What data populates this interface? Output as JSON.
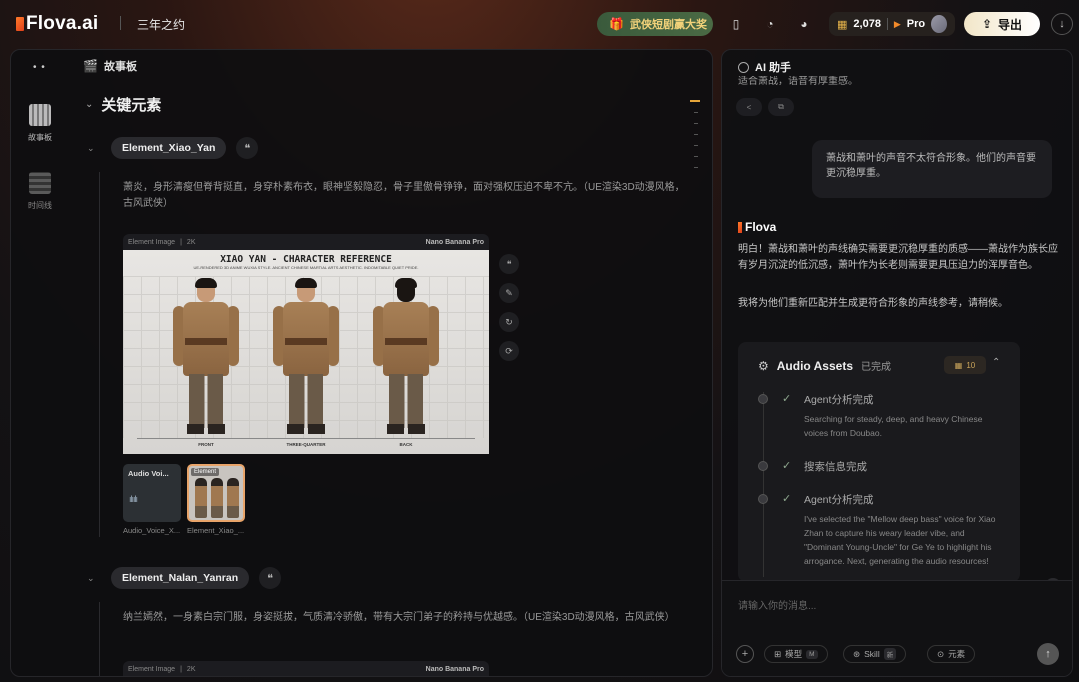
{
  "header": {
    "logo_text": "Flova.ai",
    "project_name": "三年之约",
    "promo_label": "武侠短剧赢大奖",
    "credits": "2,078",
    "plan": "Pro",
    "export_label": "导出"
  },
  "sidebar": {
    "items": [
      {
        "label": "故事板"
      },
      {
        "label": "时间线"
      }
    ]
  },
  "board": {
    "title": "故事板",
    "section_title": "关键元素",
    "elements": [
      {
        "name": "Element_Xiao_Yan",
        "desc": "萧炎，身形清瘦但脊背挺直，身穿朴素布衣，眼神坚毅隐忍，骨子里傲骨铮铮，面对强权压迫不卑不亢。（UE渲染3D动漫风格，古风武侠）",
        "image_meta": {
          "kind": "Element Image",
          "res": "2K",
          "model": "Nano Banana Pro"
        },
        "image_title": "XIAO YAN - CHARACTER REFERENCE",
        "image_subtitle": "UE-RENDERED 3D ANIME WUXIA STYLE. ANCIENT CHINESE MARTIAL ARTS AESTHETIC. INDOMITABLE QUIET PRIDE.",
        "views": [
          "FRONT",
          "THREE-QUARTER",
          "BACK"
        ],
        "thumbs": [
          {
            "label": "Audio Voi...",
            "caption": "Audio_Voice_X..."
          },
          {
            "label": "Element",
            "caption": "Element_Xiao_..."
          }
        ]
      },
      {
        "name": "Element_Nalan_Yanran",
        "desc": "纳兰嫣然，一身素白宗门服，身姿挺拔，气质清冷骄傲，带有大宗门弟子的矜持与优越感。（UE渲染3D动漫风格，古风武侠）",
        "image_meta": {
          "kind": "Element Image",
          "res": "2K",
          "model": "Nano Banana Pro"
        }
      }
    ]
  },
  "assistant": {
    "title": "AI 助手",
    "cut_text": "适合萧战，语音有厚重感。",
    "user_message": "萧战和萧叶的声音不太符合形象。他们的声音要更沉稳厚重。",
    "bot_name": "Flova",
    "reply_1": "明白！萧战和萧叶的声线确实需要更沉稳厚重的质感——萧战作为族长应有岁月沉淀的低沉感，萧叶作为长老则需要更具压迫力的浑厚音色。",
    "reply_2": "我将为他们重新匹配并生成更符合形象的声线参考，请稍候。",
    "assets": {
      "title": "Audio Assets",
      "status": "已完成",
      "cost": "10",
      "steps": [
        {
          "label": "Agent分析完成",
          "detail": "Searching for steady, deep, and heavy Chinese voices from Doubao."
        },
        {
          "label": "搜索信息完成",
          "detail": ""
        },
        {
          "label": "Agent分析完成",
          "detail": "I've selected the \"Mellow deep bass\" voice for Xiao Zhan to capture his weary leader vibe, and \"Dominant Young-Uncle\" for Ge Ye to highlight his arrogance. Next, generating the audio resources!"
        }
      ]
    },
    "composer": {
      "placeholder": "请输入你的消息...",
      "chips": [
        {
          "label": "模型",
          "badge": "M"
        },
        {
          "label": "Skill",
          "badge": "新"
        },
        {
          "label": "元素",
          "badge": ""
        }
      ]
    }
  }
}
